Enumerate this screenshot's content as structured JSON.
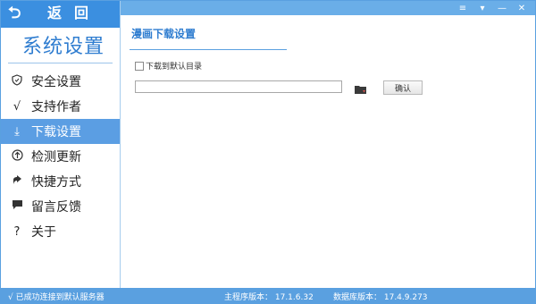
{
  "back": {
    "icon": "back-arrow-icon",
    "label": "返回"
  },
  "sidebar": {
    "title": "系统设置",
    "items": [
      {
        "icon": "shield-icon",
        "label": "安全设置"
      },
      {
        "icon": "check-icon",
        "label": "支持作者"
      },
      {
        "icon": "download-icon",
        "label": "下载设置",
        "active": true
      },
      {
        "icon": "update-icon",
        "label": "检测更新"
      },
      {
        "icon": "shortcut-icon",
        "label": "快捷方式"
      },
      {
        "icon": "message-icon",
        "label": "留言反馈"
      },
      {
        "icon": "question-icon",
        "label": "关于"
      }
    ]
  },
  "window_controls": [
    "menu-icon",
    "dropdown-icon",
    "minimize-icon",
    "close-icon"
  ],
  "main": {
    "title": "漫画下载设置",
    "checkbox_label": "下载到默认目录",
    "path_value": "",
    "ok_label": "确认"
  },
  "status": {
    "connection": "√ 已成功连接到默认服务器",
    "main_version": "主程序版本： 17.1.6.32",
    "db_version": "数据库版本： 17.4.9.273"
  },
  "colors": {
    "accent": "#3b8fe0",
    "active_item": "#5b9ee3",
    "statusbar": "#5aa0e0"
  }
}
